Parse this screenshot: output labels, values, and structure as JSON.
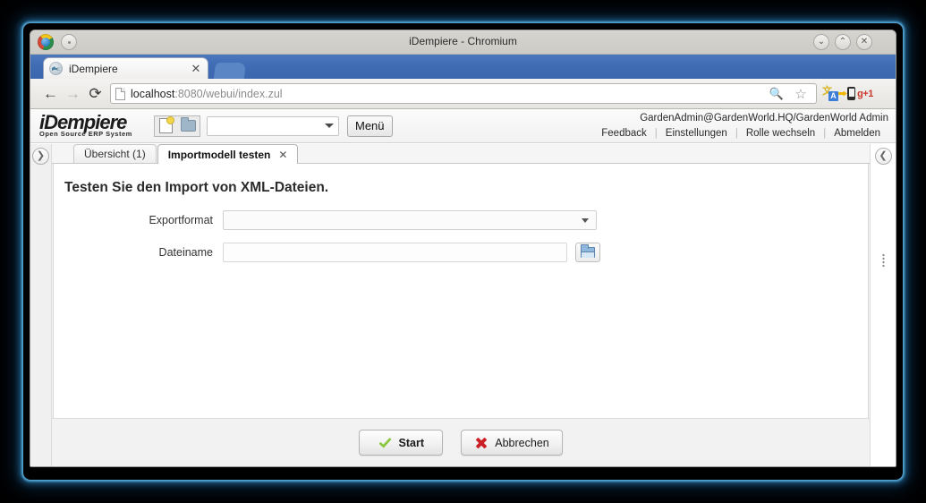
{
  "window": {
    "title": "iDempiere - Chromium",
    "controls": {
      "minimize": "⌄",
      "maximize": "⌃",
      "close": "✕"
    }
  },
  "browser": {
    "tab": {
      "title": "iDempiere",
      "close": "✕",
      "favicon": "idempiere-favicon"
    },
    "nav": {
      "back": "←",
      "forward": "→",
      "reload": "⟳"
    },
    "omnibox": {
      "url_host": "localhost",
      "url_rest": ":8080/webui/index.zul",
      "icons": {
        "zoom": "🔍",
        "bookmark": "☆",
        "translate_a": "A",
        "translate_b": "文",
        "gplus": "g+1"
      }
    }
  },
  "app_header": {
    "logo_main": "iDempiere",
    "logo_sub": "Open Source ERP System",
    "combo_value": "",
    "menu_label": "Menü",
    "user": "GardenAdmin@GardenWorld.HQ/GardenWorld Admin",
    "links": [
      "Feedback",
      "Einstellungen",
      "Rolle wechseln",
      "Abmelden"
    ],
    "separator": "|"
  },
  "rails": {
    "left_toggle": "❯",
    "right_toggle": "❮"
  },
  "tabs": [
    {
      "label": "Übersicht (1)",
      "active": false,
      "closable": false
    },
    {
      "label": "Importmodell testen",
      "active": true,
      "closable": true,
      "close": "✕"
    }
  ],
  "form": {
    "title": "Testen Sie den Import von XML-Dateien.",
    "fields": [
      {
        "label": "Exportformat",
        "type": "combobox",
        "value": "",
        "placeholder": ""
      },
      {
        "label": "Dateiname",
        "type": "text-with-browse",
        "value": "",
        "placeholder": "",
        "browse_icon": "open-folder-icon"
      }
    ]
  },
  "footer": {
    "buttons": [
      {
        "label": "Start",
        "icon": "green-check-icon",
        "primary": true
      },
      {
        "label": "Abbrechen",
        "icon": "red-x-icon",
        "primary": false
      }
    ]
  }
}
